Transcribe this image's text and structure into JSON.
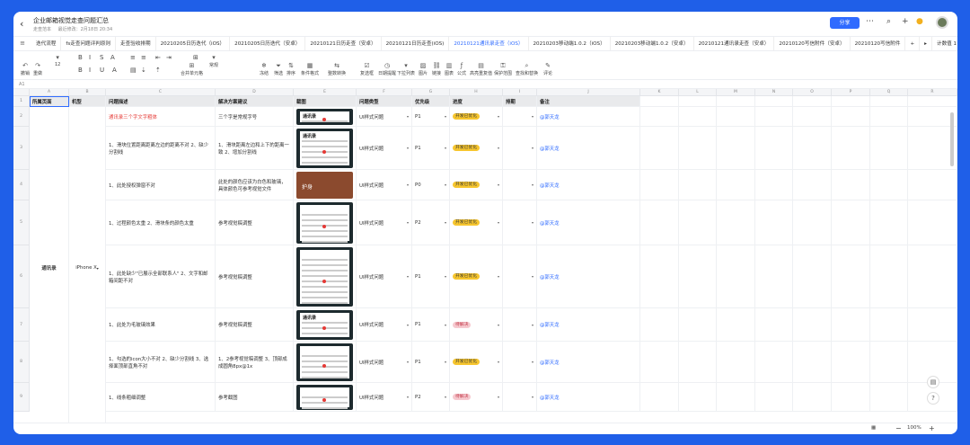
{
  "title_bar": {
    "doc_title": "企业邮箱视觉走查问题汇总",
    "location": "走查范本",
    "edited": "最近修改：2月18日 20:34",
    "share_label": "分享"
  },
  "tabs": [
    "迭代流程",
    "fs走查问题评判原则",
    "走查验收排期",
    "20210205日历迭代（iOS）",
    "20210205日历迭代（安卓）",
    "20210121日历走查（安卓）",
    "20210121日历走查(iOS)",
    "20210121通讯录走查（iOS）",
    "20210203移动端1.0.2（iOS）",
    "20210203移动端1.0.2（安卓）",
    "20210121通讯录走查（安卓）",
    "20210120写信附件（安卓）",
    "20210120写信附件"
  ],
  "active_tab": 7,
  "tabs_extra": {
    "add": "+",
    "more": "▸",
    "calc": "计数值 1"
  },
  "toolbar": {
    "undo": "撤销",
    "redo": "重做",
    "font_size": "12",
    "format": "常规",
    "merge": "合并单元格",
    "freeze": "冻结",
    "filter": "筛选",
    "sort": "排序",
    "cond_format": "条件格式",
    "data_convert": "整数转换",
    "check": "复选框",
    "date_remind": "日期提醒",
    "dropdown": "下拉列表",
    "image": "图片",
    "link": "链接",
    "chart": "图表",
    "formula": "公式",
    "find": "高亮重复值",
    "protect": "保护范围",
    "query": "查找和替换",
    "comment": "评论"
  },
  "formula_bar": {
    "cell": "A1"
  },
  "columns": [
    "A",
    "B",
    "C",
    "D",
    "E",
    "F",
    "G",
    "H",
    "I",
    "J",
    "K",
    "L",
    "M",
    "N",
    "O",
    "P",
    "Q",
    "R"
  ],
  "header_row": [
    "所属页面",
    "机型",
    "问题描述",
    "解决方案建议",
    "截图",
    "问题类型",
    "优先级",
    "进度",
    "排期",
    "备注"
  ],
  "rows": [
    {
      "num": "2",
      "desc": "通讯录三个字文字粗体",
      "fix": "三个字是常规字号",
      "type": "UI样式问题",
      "prio": "P1",
      "status": "开发已优化",
      "note": "@郭天龙"
    },
    {
      "num": "3",
      "desc": "1、滑块位置距离距离左边的距离不对 2、缺少分割线",
      "fix": "1、滑块距离左边和上下的距离一致 2、增加分割线",
      "type": "UI样式问题",
      "prio": "P1",
      "status": "开发已优化",
      "note": "@郭天龙"
    },
    {
      "num": "4",
      "desc": "1、此处授权弹窗不对",
      "fix": "此处的颜色应该为白色和玻璃，具体颜色可参考视觉文件",
      "type": "UI样式问题",
      "prio": "P0",
      "status": "开发已优化",
      "note": "@郭天龙"
    },
    {
      "num": "5",
      "desc": "1、过程颜色太重 2、滑块条的颜色太重",
      "fix": "参考视觉稿调整",
      "type": "UI样式问题",
      "prio": "P2",
      "status": "开发已优化",
      "note": "@郭天龙"
    },
    {
      "num": "6",
      "desc": "1、此处缺少\"已展示全部联系人\" 2、文字和邮箱间距不对",
      "fix": "参考视觉稿调整",
      "type": "UI样式问题",
      "prio": "P1",
      "status": "开发已优化",
      "note": "@郭天龙"
    },
    {
      "num": "7",
      "desc": "1、此处为毛玻璃效果",
      "fix": "参考视觉稿调整",
      "type": "UI样式问题",
      "prio": "P1",
      "status": "待解决",
      "note": "@郭天龙"
    },
    {
      "num": "8",
      "desc": "1、勾选的icon大小不对 2、缺少分割线 3、选择面顶部直角不对",
      "fix": "1、2参考视觉稿调整 3、顶部成成圆角8px@1x",
      "type": "UI样式问题",
      "prio": "P1",
      "status": "开发已优化",
      "note": "@郭天龙"
    },
    {
      "num": "9",
      "desc": "1、线条粗细调整",
      "fix": "参考截图",
      "type": "UI样式问题",
      "prio": "P2",
      "status": "待解决",
      "note": "@郭天龙"
    }
  ],
  "merged": {
    "page": "通讯录",
    "model": "iPhone X"
  },
  "screenshot_text": {
    "top": "通讯录",
    "brown": "护身"
  },
  "colors": {
    "accent": "#2f6bff",
    "yellow": "#f7c62f",
    "pink": "#f6c9cf",
    "red": "#e53935"
  },
  "status_bar": {
    "zoom": "100%",
    "minus": "−",
    "plus": "+"
  }
}
